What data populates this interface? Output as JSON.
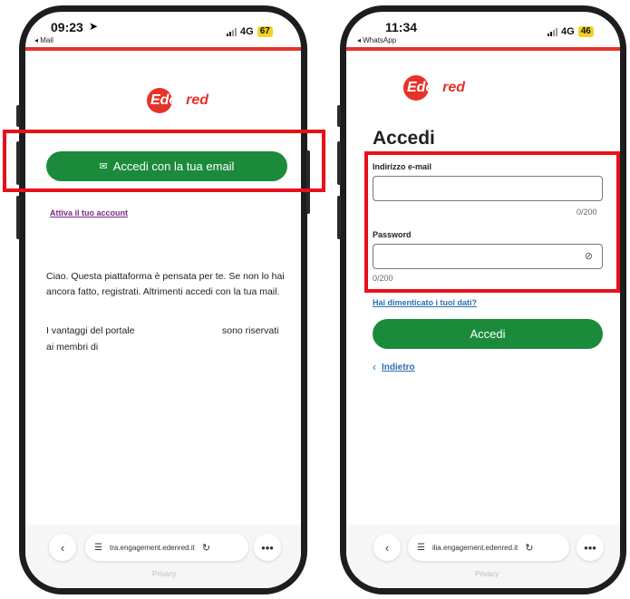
{
  "left": {
    "status": {
      "time": "09:23",
      "back_app": "◂ Mail",
      "network": "4G",
      "battery": "67"
    },
    "login_button": "Accedi con la tua email",
    "activate_link": "Attiva il tuo account",
    "paragraph1": "Ciao. Questa piattaforma è pensata per te. Se non lo hai ancora fatto, registrati. Altrimenti accedi con la tua mail.",
    "paragraph2_part1": "I vantaggi del portale",
    "paragraph2_part2": "sono riservati",
    "paragraph2_part3": "ai membri di",
    "url": "tra.engagement.edenred.it",
    "footer": "Privacy"
  },
  "right": {
    "status": {
      "time": "11:34",
      "back_app": "◂ WhatsApp",
      "network": "4G",
      "battery": "46"
    },
    "heading": "Accedi",
    "email_label": "Indirizzo e-mail",
    "email_value": "",
    "email_counter": "0/200",
    "password_label": "Password",
    "password_value": "",
    "password_counter": "0/200",
    "forgot_link": "Hai dimenticato i tuoi dati?",
    "submit_button": "Accedi",
    "back_link": "Indietro",
    "url": "ilia.engagement.edenred.it",
    "footer": "Privacy"
  },
  "brand": {
    "logo_text_1": "Eden",
    "logo_text_2": "red",
    "red": "#e6332a",
    "green": "#1b8b3b",
    "highlight": "#e8101a"
  },
  "icons": [
    "location-arrow-icon",
    "mail-icon",
    "eye-off-icon",
    "chevron-left-icon",
    "tabs-icon",
    "reload-icon",
    "more-icon"
  ]
}
